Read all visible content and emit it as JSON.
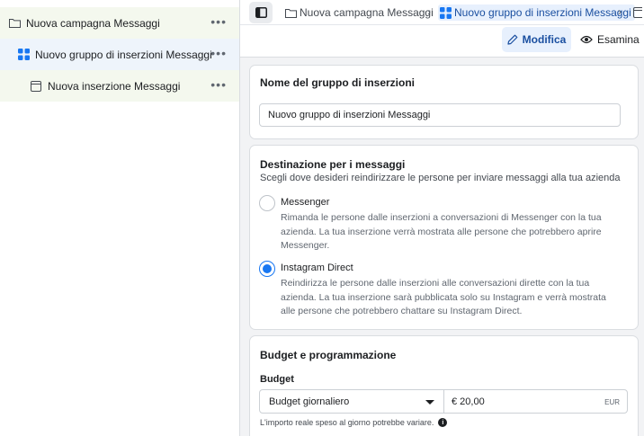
{
  "tree": {
    "campaign": {
      "label": "Nuova campagna Messaggi",
      "icon": "folder-icon"
    },
    "adset": {
      "label": "Nuovo gruppo di inserzioni Messaggi",
      "icon": "grid-icon"
    },
    "ad": {
      "label": "Nuova inserzione Messaggi",
      "icon": "ad-page-icon"
    },
    "more_label": "•••"
  },
  "breadcrumb": {
    "campaign": "Nuova campagna Messaggi",
    "adset": "Nuovo gruppo di inserzioni Messaggi",
    "separator": "›"
  },
  "actions": {
    "edit_label": "Modifica",
    "review_label": "Esamina"
  },
  "adset_name": {
    "title": "Nome del gruppo di inserzioni",
    "value": "Nuovo gruppo di inserzioni Messaggi"
  },
  "destination": {
    "title": "Destinazione per i messaggi",
    "subtitle": "Scegli dove desideri reindirizzare le persone per inviare messaggi alla tua azienda",
    "options": [
      {
        "label": "Messenger",
        "description": "Rimanda le persone dalle inserzioni a conversazioni di Messenger con la tua azienda. La tua inserzione verrà mostrata alle persone che potrebbero aprire Messenger.",
        "selected": false
      },
      {
        "label": "Instagram Direct",
        "description": "Reindirizza le persone dalle inserzioni alle conversazioni dirette con la tua azienda. La tua inserzione sarà pubblicata solo su Instagram e verrà mostrata alle persone che potrebbero chattare su Instagram Direct.",
        "selected": true
      }
    ]
  },
  "budget": {
    "title": "Budget e programmazione",
    "label": "Budget",
    "type": "Budget giornaliero",
    "amount": "€ 20,00",
    "currency": "EUR",
    "note": "L'importo reale speso al giorno potrebbe variare.",
    "info": "i"
  },
  "colors": {
    "accent": "#1877f2",
    "selected_bg": "#e7f0fd",
    "campaign_row_bg": "#f4f8ee"
  }
}
